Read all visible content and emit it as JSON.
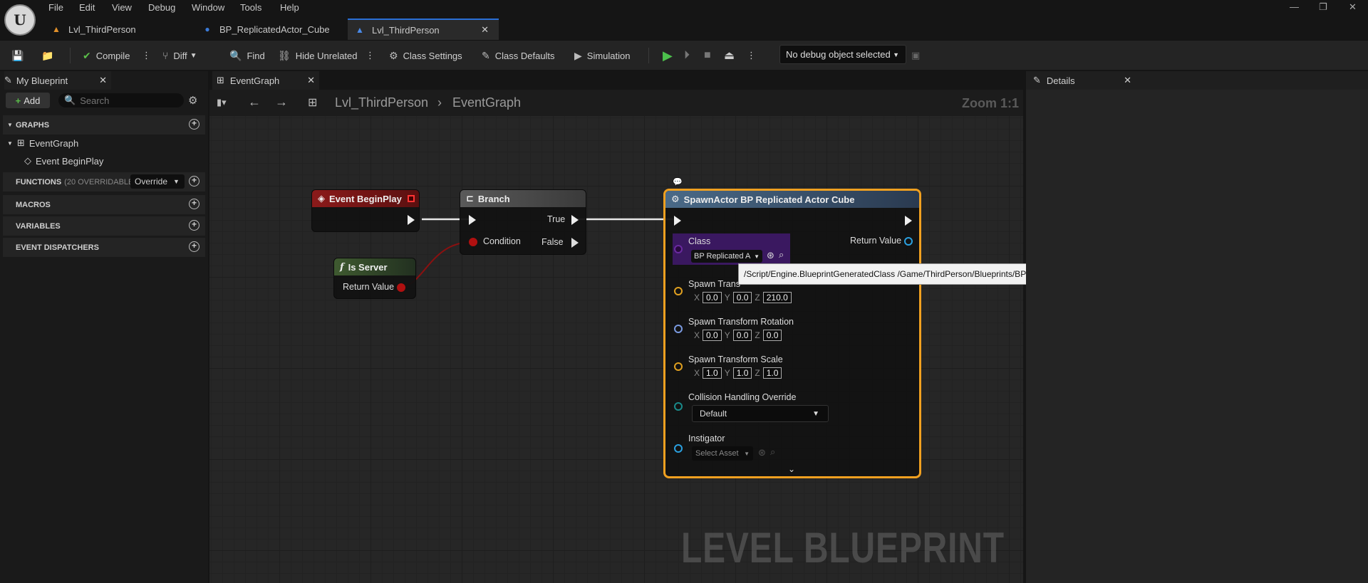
{
  "menu": [
    "File",
    "Edit",
    "View",
    "Debug",
    "Window",
    "Tools",
    "Help"
  ],
  "doc_tabs": [
    {
      "label": "Lvl_ThirdPerson"
    },
    {
      "label": "BP_ReplicatedActor_Cube"
    },
    {
      "label": "Lvl_ThirdPerson"
    }
  ],
  "toolbar": {
    "compile": "Compile",
    "diff": "Diff",
    "find": "Find",
    "hide_unrelated": "Hide Unrelated",
    "class_settings": "Class Settings",
    "class_defaults": "Class Defaults",
    "simulation": "Simulation",
    "debug_object": "No debug object selected"
  },
  "my_blueprint": {
    "tab_label": "My Blueprint",
    "add_label": "Add",
    "search_placeholder": "Search",
    "sections": {
      "graphs": "GRAPHS",
      "functions": "FUNCTIONS",
      "functions_count": "(20 OVERRIDABLE)",
      "override": "Override",
      "macros": "MACROS",
      "variables": "VARIABLES",
      "dispatchers": "EVENT DISPATCHERS"
    },
    "graph_items": [
      "EventGraph",
      "Event BeginPlay"
    ]
  },
  "graph": {
    "tab_label": "EventGraph",
    "breadcrumb": [
      "Lvl_ThirdPerson",
      "EventGraph"
    ],
    "zoom": "Zoom 1:1",
    "watermark": "LEVEL BLUEPRINT"
  },
  "details": {
    "tab_label": "Details"
  },
  "nodes": {
    "begin_play": {
      "title": "Event BeginPlay"
    },
    "is_server": {
      "title": "Is Server",
      "return_value": "Return Value"
    },
    "branch": {
      "title": "Branch",
      "condition": "Condition",
      "true_label": "True",
      "false_label": "False"
    },
    "spawn": {
      "title": "SpawnActor BP Replicated Actor Cube",
      "class_label": "Class",
      "class_value": "BP Replicated A",
      "return_value": "Return Value",
      "spawn_translation": "Spawn Trans",
      "translation": {
        "x": "0.0",
        "y": "0.0",
        "z": "210.0"
      },
      "spawn_rotation": "Spawn Transform Rotation",
      "rotation": {
        "x": "0.0",
        "y": "0.0",
        "z": "0.0"
      },
      "spawn_scale": "Spawn Transform Scale",
      "scale": {
        "x": "1.0",
        "y": "1.0",
        "z": "1.0"
      },
      "collision": "Collision Handling Override",
      "collision_value": "Default",
      "instigator": "Instigator",
      "instigator_value": "Select Asset"
    }
  },
  "tooltip": "/Script/Engine.BlueprintGeneratedClass /Game/ThirdPerson/Blueprints/BP_ReplicatedActor_Cube.BP_ReplicatedActor_Cube_C",
  "colors": {
    "accent": "#2a6fd6",
    "selected_node": "#f0a020",
    "event_header": "#8b1a1a",
    "class_pin": "#5a1a8a"
  }
}
